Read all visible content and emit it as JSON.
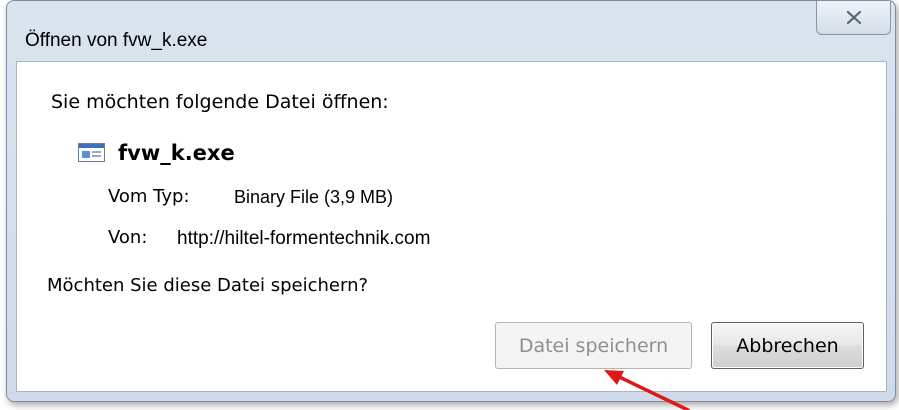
{
  "dialog": {
    "title": "Öffnen von fvw_k.exe",
    "close_icon": "close-icon",
    "prompt": "Sie möchten folgende Datei öffnen:",
    "file": {
      "icon": "executable-file-icon",
      "name": "fvw_k.exe",
      "type_label": "Vom Typ:",
      "type_value": "Binary File (3,9 MB)",
      "from_label": "Von:",
      "from_value": "http://hiltel-formentechnik.com"
    },
    "question": "Möchten Sie diese Datei speichern?",
    "buttons": {
      "save_label": "Datei speichern",
      "save_enabled": false,
      "cancel_label": "Abbrechen"
    }
  },
  "annotation": {
    "arrow_color": "#e01818"
  }
}
